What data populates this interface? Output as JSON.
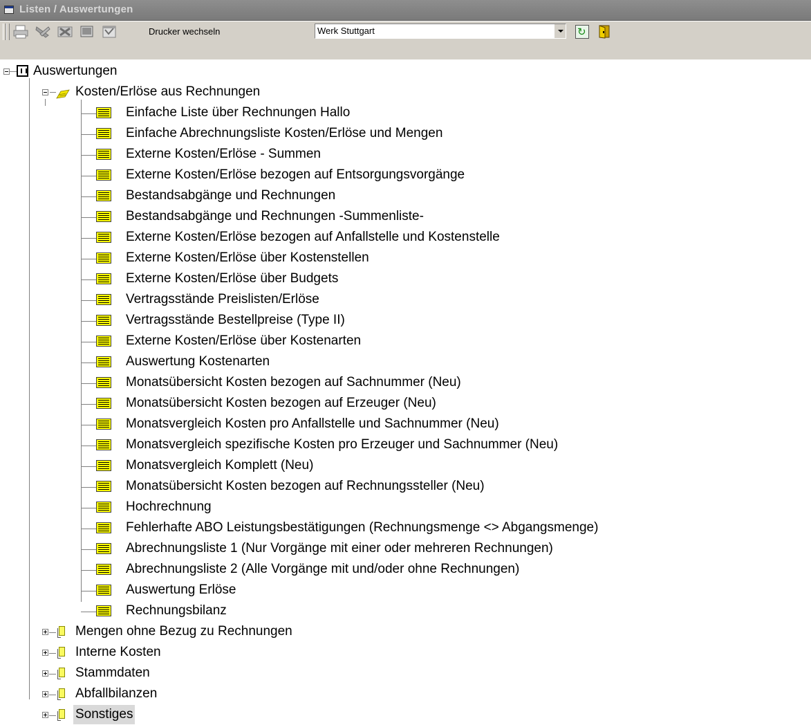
{
  "window": {
    "title": "Listen / Auswertungen"
  },
  "toolbar": {
    "icons": [
      "print-icon",
      "tools-icon",
      "excel-export-icon",
      "preview-icon",
      "report-icon"
    ],
    "printer_label": "Drucker wechseln",
    "printer_value": "Werk Stuttgart",
    "refresh_icon": "refresh-icon",
    "exit_icon": "exit-icon"
  },
  "tree": {
    "root": "Auswertungen",
    "expanded_folder": "Kosten/Erlöse aus Rechnungen",
    "items": [
      "Einfache Liste über Rechnungen Hallo",
      "Einfache Abrechnungsliste Kosten/Erlöse und Mengen",
      "Externe Kosten/Erlöse - Summen",
      "Externe Kosten/Erlöse bezogen auf Entsorgungsvorgänge",
      "Bestandsabgänge und Rechnungen",
      "Bestandsabgänge und Rechnungen -Summenliste-",
      "Externe Kosten/Erlöse bezogen auf Anfallstelle und Kostenstelle",
      "Externe Kosten/Erlöse über Kostenstellen",
      "Externe Kosten/Erlöse über Budgets",
      "Vertragsstände Preislisten/Erlöse",
      "Vertragsstände Bestellpreise (Type II)",
      "Externe Kosten/Erlöse über Kostenarten",
      "Auswertung Kostenarten",
      "Monatsübersicht Kosten bezogen auf Sachnummer (Neu)",
      "Monatsübersicht Kosten bezogen auf Erzeuger (Neu)",
      "Monatsvergleich Kosten pro Anfallstelle und Sachnummer (Neu)",
      "Monatsvergleich spezifische Kosten pro Erzeuger und Sachnummer (Neu)",
      "Monatsvergleich Komplett (Neu)",
      "Monatsübersicht Kosten bezogen auf Rechnungssteller (Neu)",
      "Hochrechnung",
      "Fehlerhafte ABO Leistungsbestätigungen (Rechnungsmenge <> Abgangsmenge)",
      "Abrechnungsliste 1 (Nur Vorgänge mit einer oder mehreren Rechnungen)",
      "Abrechnungsliste 2 (Alle Vorgänge mit und/oder ohne Rechnungen)",
      "Auswertung Erlöse",
      "Rechnungsbilanz"
    ],
    "collapsed_folders": [
      "Mengen ohne Bezug zu Rechnungen",
      "Interne Kosten",
      "Stammdaten",
      "Abfallbilanzen",
      "Sonstiges"
    ],
    "selected": "Sonstiges"
  },
  "colors": {
    "titlebar": "#7f7f7f",
    "toolbar": "#d4d0c8",
    "list_icon": "#ffff00",
    "selection": "#d9d9d9"
  }
}
